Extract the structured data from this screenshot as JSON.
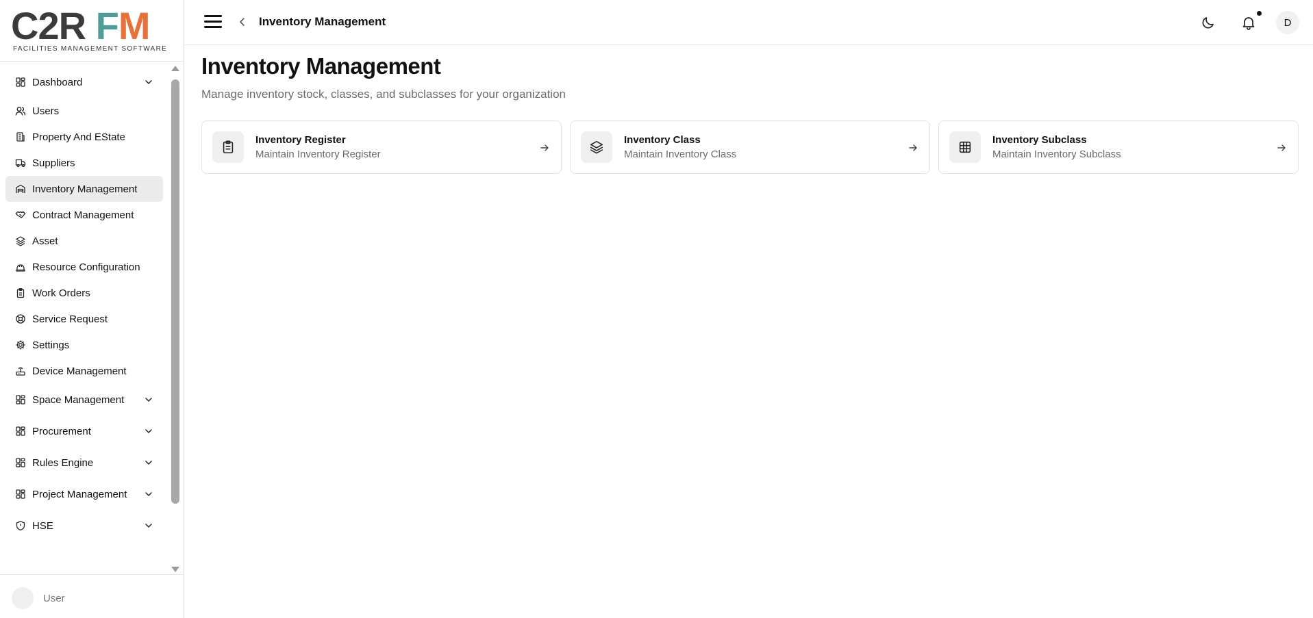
{
  "logo": {
    "brand_c2r": "C2R",
    "brand_f": "F",
    "brand_m": "M",
    "tagline": "FACILITIES MANAGEMENT SOFTWARE"
  },
  "sidebar": {
    "items": [
      {
        "label": "Dashboard",
        "icon": "dashboard-icon",
        "expandable": true
      },
      {
        "label": "Users",
        "icon": "users-icon",
        "expandable": false
      },
      {
        "label": "Property And EState",
        "icon": "building-icon",
        "expandable": false
      },
      {
        "label": "Suppliers",
        "icon": "truck-icon",
        "expandable": false
      },
      {
        "label": "Inventory Management",
        "icon": "warehouse-icon",
        "expandable": false,
        "active": true
      },
      {
        "label": "Contract Management",
        "icon": "handshake-icon",
        "expandable": false
      },
      {
        "label": "Asset",
        "icon": "layers-icon",
        "expandable": false
      },
      {
        "label": "Resource Configuration",
        "icon": "hard-hat-icon",
        "expandable": false
      },
      {
        "label": "Work Orders",
        "icon": "clipboard-icon",
        "expandable": false
      },
      {
        "label": "Service Request",
        "icon": "lifebuoy-icon",
        "expandable": false
      },
      {
        "label": "Settings",
        "icon": "gear-icon",
        "expandable": false
      },
      {
        "label": "Device Management",
        "icon": "router-icon",
        "expandable": false
      },
      {
        "label": "Space Management",
        "icon": "dashboard-icon",
        "expandable": true
      },
      {
        "label": "Procurement",
        "icon": "dashboard-icon",
        "expandable": true
      },
      {
        "label": "Rules Engine",
        "icon": "dashboard-icon",
        "expandable": true
      },
      {
        "label": "Project Management",
        "icon": "dashboard-icon",
        "expandable": true
      },
      {
        "label": "HSE",
        "icon": "shield-icon",
        "expandable": true
      }
    ],
    "user_label": "User"
  },
  "header": {
    "title": "Inventory Management",
    "avatar_initial": "D"
  },
  "main": {
    "title": "Inventory Management",
    "subtitle": "Manage inventory stock, classes, and subclasses for your organization",
    "cards": [
      {
        "title": "Inventory Register",
        "description": "Maintain Inventory Register",
        "icon": "clipboard-list-icon"
      },
      {
        "title": "Inventory Class",
        "description": "Maintain Inventory Class",
        "icon": "layers-icon"
      },
      {
        "title": "Inventory Subclass",
        "description": "Maintain Inventory Subclass",
        "icon": "grid-icon"
      }
    ]
  },
  "colors": {
    "brand_dark": "#3b3b3b",
    "brand_teal": "#4e9d98",
    "brand_orange": "#e8703a",
    "active_bg": "#ebebeb"
  }
}
